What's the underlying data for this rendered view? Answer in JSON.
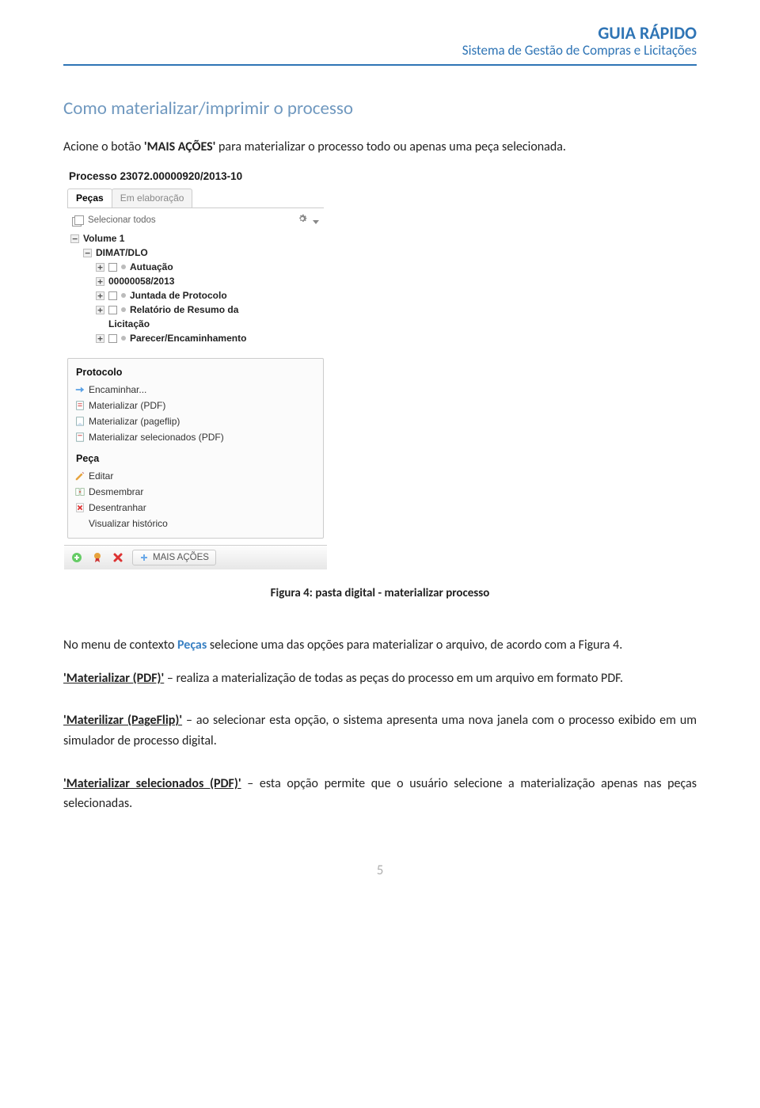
{
  "header": {
    "title": "GUIA RÁPIDO",
    "subtitle": "Sistema de Gestão de Compras e Licitações"
  },
  "section_head": "Como materializar/imprimir o processo",
  "intro_pre": "Acione o botão ",
  "intro_bold": "'MAIS AÇÕES'",
  "intro_post": " para materializar o processo todo ou apenas uma peça selecionada.",
  "caption": "Figura 4: pasta digital - materializar processo",
  "para2_pre": "No menu de contexto ",
  "para2_pecas": "Peças",
  "para2_post": " selecione uma das opções para materializar o arquivo, de acordo com a Figura 4.",
  "def1_term": "'Materializar (PDF)'",
  "def1_rest": " – realiza a materialização de todas as peças do processo em um arquivo em formato PDF.",
  "def2_term": "'Materilizar (PageFlip)'",
  "def2_rest": " – ao selecionar esta opção, o sistema apresenta uma nova janela com o processo exibido em um simulador de processo digital.",
  "def3_term": "'Materializar selecionados (PDF)'",
  "def3_rest": " – esta opção permite que o usuário selecione a materialização apenas nas peças selecionadas.",
  "page_num": "5",
  "ui": {
    "window_title": "Processo 23072.00000920/2013-10",
    "tab_pecas": "Peças",
    "tab_elab": "Em elaboração",
    "select_all": "Selecionar todos",
    "tree": {
      "volume": "Volume 1",
      "dimat": "DIMAT/DLO",
      "autu": "Autuação",
      "proc": "00000058/2013",
      "juntada": "Juntada de Protocolo",
      "relatorio": "Relatório de Resumo da",
      "licitacao": "Licitação",
      "parecer": "Parecer/Encaminhamento"
    },
    "menu": {
      "protocolo_head": "Protocolo",
      "encaminhar": "Encaminhar...",
      "mat_pdf": "Materializar (PDF)",
      "mat_pageflip": "Materializar (pageflip)",
      "mat_sel": "Materializar selecionados (PDF)",
      "peca_head": "Peça",
      "editar": "Editar",
      "desmembrar": "Desmembrar",
      "desentranhar": "Desentranhar",
      "visualizar": "Visualizar histórico"
    },
    "mais_acoes": "MAIS AÇÕES"
  }
}
